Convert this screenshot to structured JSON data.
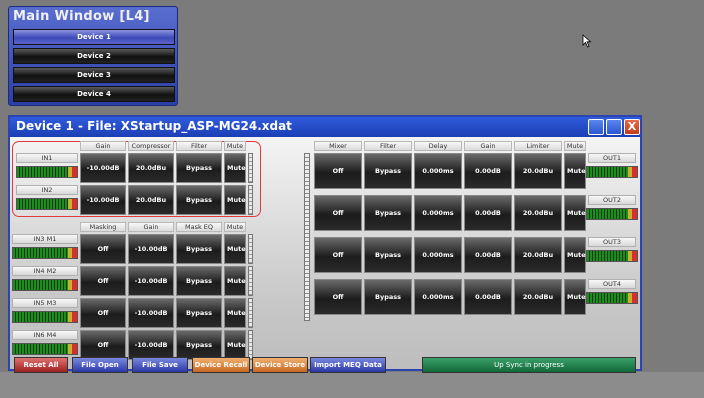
{
  "main_window": {
    "title": "Main Window [L4]",
    "devices": [
      "Device 1",
      "Device 2",
      "Device 3",
      "Device 4"
    ]
  },
  "device_window": {
    "title": "Device 1  -  File: XStartup_ASP-MG24.xdat",
    "close_glyph": "X"
  },
  "inputs": {
    "headers": [
      "Gain",
      "Compressor",
      "Filter",
      "Mute"
    ],
    "rows": [
      {
        "label": "IN1",
        "gain": "-10.00dB",
        "compressor": "20.0dBu",
        "filter": "Bypass",
        "mute": "Mute"
      },
      {
        "label": "IN2",
        "gain": "-10.00dB",
        "compressor": "20.0dBu",
        "filter": "Bypass",
        "mute": "Mute"
      }
    ]
  },
  "mics": {
    "headers": [
      "Masking",
      "Gain",
      "Mask EQ",
      "Mute"
    ],
    "rows": [
      {
        "label": "IN3 M1",
        "masking": "Off",
        "gain": "-10.00dB",
        "mask_eq": "Bypass",
        "mute": "Mute"
      },
      {
        "label": "IN4 M2",
        "masking": "Off",
        "gain": "-10.00dB",
        "mask_eq": "Bypass",
        "mute": "Mute"
      },
      {
        "label": "IN5 M3",
        "masking": "Off",
        "gain": "-10.00dB",
        "mask_eq": "Bypass",
        "mute": "Mute"
      },
      {
        "label": "IN6 M4",
        "masking": "Off",
        "gain": "-10.00dB",
        "mask_eq": "Bypass",
        "mute": "Mute"
      }
    ]
  },
  "outputs": {
    "headers": [
      "Mixer",
      "Filter",
      "Delay",
      "Gain",
      "Limiter",
      "Mute"
    ],
    "rows": [
      {
        "label": "OUT1",
        "mixer": "Off",
        "filter": "Bypass",
        "delay": "0.000ms",
        "gain": "0.00dB",
        "limiter": "20.0dBu",
        "mute": "Mute"
      },
      {
        "label": "OUT2",
        "mixer": "Off",
        "filter": "Bypass",
        "delay": "0.000ms",
        "gain": "0.00dB",
        "limiter": "20.0dBu",
        "mute": "Mute"
      },
      {
        "label": "OUT3",
        "mixer": "Off",
        "filter": "Bypass",
        "delay": "0.000ms",
        "gain": "0.00dB",
        "limiter": "20.0dBu",
        "mute": "Mute"
      },
      {
        "label": "OUT4",
        "mixer": "Off",
        "filter": "Bypass",
        "delay": "0.000ms",
        "gain": "0.00dB",
        "limiter": "20.0dBu",
        "mute": "Mute"
      }
    ]
  },
  "footer": {
    "reset_all": "Reset All",
    "file_open": "File Open",
    "file_save": "File Save",
    "device_recall": "Device Recall",
    "device_store": "Device Store",
    "import_meq": "Import MEQ Data",
    "status": "Up Sync in progress"
  },
  "colors": {
    "titlebar": "#1c3eb4",
    "highlight": "#e03a3a",
    "status_green": "#106838"
  }
}
